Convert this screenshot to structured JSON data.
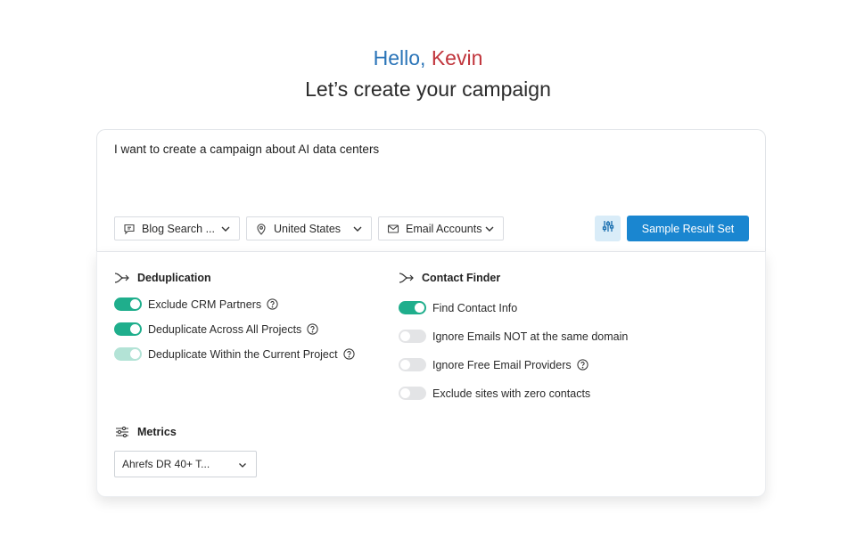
{
  "header": {
    "hello": "Hello,",
    "name": "Kevin",
    "subtitle": "Let’s create your campaign"
  },
  "prompt": {
    "text": "I want to create a campaign about AI data centers"
  },
  "filters": {
    "blog_search": "Blog Search ...",
    "country": "United States",
    "email_accounts": "Email Accounts"
  },
  "actions": {
    "sample_result_set": "Sample Result Set"
  },
  "deduplication": {
    "title": "Deduplication",
    "items": [
      {
        "label": "Exclude CRM Partners",
        "state": "on"
      },
      {
        "label": "Deduplicate Across All Projects",
        "state": "on"
      },
      {
        "label": "Deduplicate Within the Current Project",
        "state": "on-disabled"
      }
    ]
  },
  "contact_finder": {
    "title": "Contact Finder",
    "items": [
      {
        "label": "Find Contact Info",
        "state": "on"
      },
      {
        "label": "Ignore Emails NOT at the same domain",
        "state": "off"
      },
      {
        "label": "Ignore Free Email Providers",
        "state": "off"
      },
      {
        "label": "Exclude sites with zero contacts",
        "state": "off"
      }
    ]
  },
  "metrics": {
    "title": "Metrics",
    "selected": "Ahrefs DR 40+ T..."
  },
  "colors": {
    "hello": "#2a74b8",
    "name": "#c0343b",
    "primary_button": "#1a86d0",
    "toggle_on": "#1fae8c"
  }
}
